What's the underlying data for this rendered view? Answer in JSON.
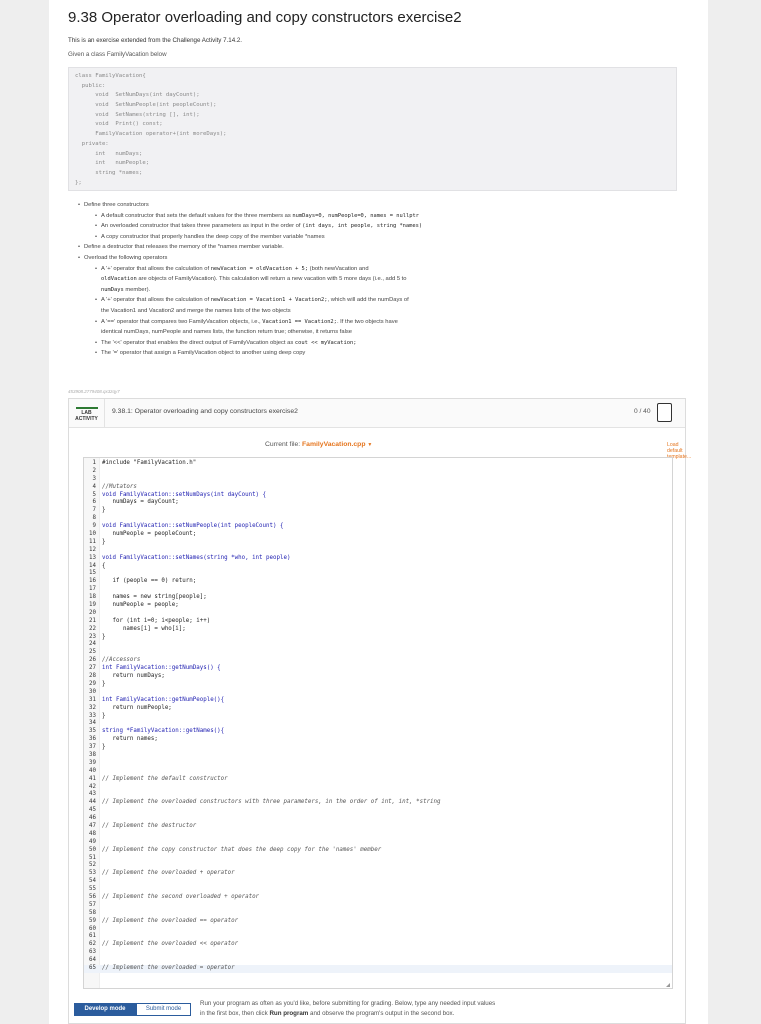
{
  "page": {
    "title": "9.38 Operator overloading and copy constructors exercise2",
    "intro_line1": "This is an exercise extended from the Challenge Activity 7.14.2.",
    "intro_line2": "Given a class FamilyVacation below"
  },
  "class_def_lines": [
    "class FamilyVacation{",
    "  public:",
    "      void  SetNumDays(int dayCount);",
    "      void  SetNumPeople(int peopleCount);",
    "      void  SetNames(string [], int);",
    "      void  Print() const;",
    "      FamilyVacation operator+(int moreDays);",
    "  private:",
    "      int   numDays;",
    "      int   numPeople;",
    "      string *names;",
    "};"
  ],
  "instructions": {
    "define_constructors": "Define three constructors",
    "c1_a": "A default constructor that sets the default values for the three members as ",
    "c1_code": "numDays=0, numPeople=0, names = nullptr",
    "c2_a": "An overloaded constructor that takes three parameters as input in the order of ",
    "c2_code": "(int days, int people, string *names)",
    "c3": "A copy constructor that properly handles the deep copy of the member variable *names",
    "destructor": "Define a destructor that releases the memory of the *names member variable.",
    "overload": "Overload the following operators",
    "o1_a": "A '+' operator that allows the calculation of ",
    "o1_code": "newVacation = oldVacation + 5;",
    "o1_b": " (both newVacation and",
    "o1_c_code": "oldVacation",
    "o1_c": " are objects of FamilyVacation). This calculation will return a new vacation with 5 more days (i.e., add 5 to",
    "o1_d_code": "numDays",
    "o1_d": " member).",
    "o2_a": "A '+' operator that allows the calculation of ",
    "o2_code": "newVacation = Vacation1 + Vacation2;",
    "o2_b": ", which will add the numDays of",
    "o2_c": "the Vacation1 and Vacation2 and merge the names lists of the two objects",
    "o3_a": "A '==' operator that compares two FamilyVacation objects, i.e., ",
    "o3_code": "Vacation1 == Vacation2;",
    "o3_b": ". If the two objects have",
    "o3_c": "identical numDays, numPeople and names lists, the function return true; otherwise, it returns false",
    "o4_a": "The '<<' operator that enables the direct output of FamilyVacation object as ",
    "o4_code": "cout << myVacation;",
    "o5": "The '=' operator that assign a FamilyVacation object to another using deep copy",
    "footnote": "453908.2779408.qx3zqy7"
  },
  "lab": {
    "badge_line1": "LAB",
    "badge_line2": "ACTIVITY",
    "title": "9.38.1: Operator overloading and copy constructors exercise2",
    "score": "0 / 40",
    "current_file_label": "Current file: ",
    "current_file": "FamilyVacation.cpp",
    "file_caret": "▼",
    "load_template": "Load default template...",
    "develop_mode": "Develop mode",
    "submit_mode": "Submit mode",
    "run_text_a": "Run your program as often as you'd like, before submitting for grading. Below, type any needed input values in the first box, then click ",
    "run_text_bold": "Run program",
    "run_text_b": " and observe the program's output in the second box."
  },
  "code_lines": [
    {
      "n": "1",
      "t": "#include \"FamilyVacation.h\"",
      "k": "inc"
    },
    {
      "n": "2",
      "t": "",
      "k": ""
    },
    {
      "n": "3",
      "t": "",
      "k": ""
    },
    {
      "n": "4",
      "t": "//Mutators",
      "k": "cm"
    },
    {
      "n": "5",
      "t": "void FamilyVacation::setNumDays(int dayCount) {",
      "k": "kw"
    },
    {
      "n": "6",
      "t": "   numDays = dayCount;",
      "k": ""
    },
    {
      "n": "7",
      "t": "}",
      "k": ""
    },
    {
      "n": "8",
      "t": "",
      "k": ""
    },
    {
      "n": "9",
      "t": "void FamilyVacation::setNumPeople(int peopleCount) {",
      "k": "kw"
    },
    {
      "n": "10",
      "t": "   numPeople = peopleCount;",
      "k": ""
    },
    {
      "n": "11",
      "t": "}",
      "k": ""
    },
    {
      "n": "12",
      "t": "",
      "k": ""
    },
    {
      "n": "13",
      "t": "void FamilyVacation::setNames(string *who, int people)",
      "k": "kw"
    },
    {
      "n": "14",
      "t": "{",
      "k": ""
    },
    {
      "n": "15",
      "t": "",
      "k": ""
    },
    {
      "n": "16",
      "t": "   if (people == 0) return;",
      "k": ""
    },
    {
      "n": "17",
      "t": "",
      "k": ""
    },
    {
      "n": "18",
      "t": "   names = new string[people];",
      "k": ""
    },
    {
      "n": "19",
      "t": "   numPeople = people;",
      "k": ""
    },
    {
      "n": "20",
      "t": "",
      "k": ""
    },
    {
      "n": "21",
      "t": "   for (int i=0; i<people; i++)",
      "k": ""
    },
    {
      "n": "22",
      "t": "      names[i] = who[i];",
      "k": ""
    },
    {
      "n": "23",
      "t": "}",
      "k": ""
    },
    {
      "n": "24",
      "t": "",
      "k": ""
    },
    {
      "n": "25",
      "t": "",
      "k": ""
    },
    {
      "n": "26",
      "t": "//Accessors",
      "k": "cm"
    },
    {
      "n": "27",
      "t": "int FamilyVacation::getNumDays() {",
      "k": "kw"
    },
    {
      "n": "28",
      "t": "   return numDays;",
      "k": ""
    },
    {
      "n": "29",
      "t": "}",
      "k": ""
    },
    {
      "n": "30",
      "t": "",
      "k": ""
    },
    {
      "n": "31",
      "t": "int FamilyVacation::getNumPeople(){",
      "k": "kw"
    },
    {
      "n": "32",
      "t": "   return numPeople;",
      "k": ""
    },
    {
      "n": "33",
      "t": "}",
      "k": ""
    },
    {
      "n": "34",
      "t": "",
      "k": ""
    },
    {
      "n": "35",
      "t": "string *FamilyVacation::getNames(){",
      "k": "kw"
    },
    {
      "n": "36",
      "t": "   return names;",
      "k": ""
    },
    {
      "n": "37",
      "t": "}",
      "k": ""
    },
    {
      "n": "38",
      "t": "",
      "k": ""
    },
    {
      "n": "39",
      "t": "",
      "k": ""
    },
    {
      "n": "40",
      "t": "",
      "k": ""
    },
    {
      "n": "41",
      "t": "// Implement the default constructor",
      "k": "cm"
    },
    {
      "n": "42",
      "t": "",
      "k": ""
    },
    {
      "n": "43",
      "t": "",
      "k": ""
    },
    {
      "n": "44",
      "t": "// Implement the overloaded constructors with three parameters, in the order of int, int, *string",
      "k": "cm"
    },
    {
      "n": "45",
      "t": "",
      "k": ""
    },
    {
      "n": "46",
      "t": "",
      "k": ""
    },
    {
      "n": "47",
      "t": "// Implement the destructor",
      "k": "cm"
    },
    {
      "n": "48",
      "t": "",
      "k": ""
    },
    {
      "n": "49",
      "t": "",
      "k": ""
    },
    {
      "n": "50",
      "t": "// Implement the copy constructor that does the deep copy for the 'names' member",
      "k": "cm"
    },
    {
      "n": "51",
      "t": "",
      "k": ""
    },
    {
      "n": "52",
      "t": "",
      "k": ""
    },
    {
      "n": "53",
      "t": "// Implement the overloaded + operator",
      "k": "cm"
    },
    {
      "n": "54",
      "t": "",
      "k": ""
    },
    {
      "n": "55",
      "t": "",
      "k": ""
    },
    {
      "n": "56",
      "t": "// Implement the second overloaded + operator",
      "k": "cm"
    },
    {
      "n": "57",
      "t": "",
      "k": ""
    },
    {
      "n": "58",
      "t": "",
      "k": ""
    },
    {
      "n": "59",
      "t": "// Implement the overloaded == operator",
      "k": "cm"
    },
    {
      "n": "60",
      "t": "",
      "k": ""
    },
    {
      "n": "61",
      "t": "",
      "k": ""
    },
    {
      "n": "62",
      "t": "// Implement the overloaded << operator",
      "k": "cm"
    },
    {
      "n": "63",
      "t": "",
      "k": ""
    },
    {
      "n": "64",
      "t": "",
      "k": ""
    },
    {
      "n": "65",
      "t": "// Implement the overloaded = operator",
      "k": "cm"
    }
  ],
  "colors": {
    "accent_orange": "#e5751e",
    "button_blue": "#2b5c9d",
    "lab_green": "#2d7a33"
  }
}
